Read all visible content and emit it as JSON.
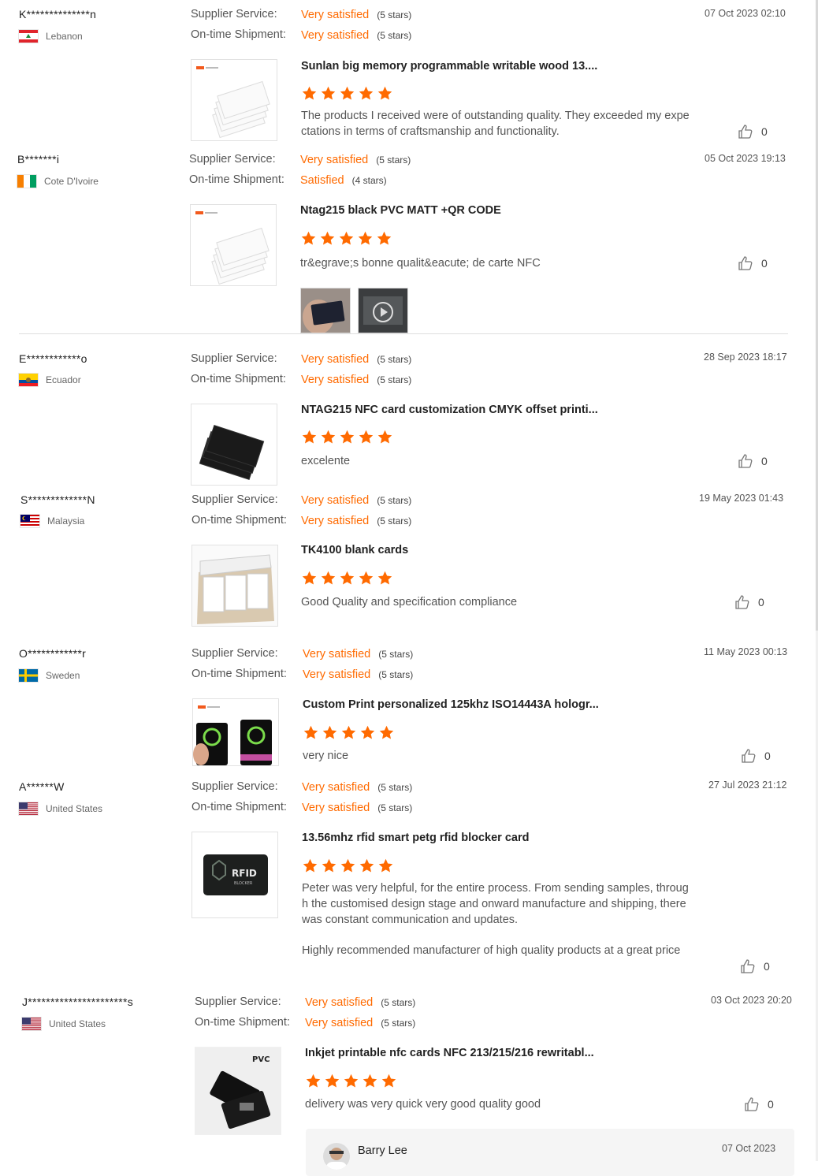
{
  "labels": {
    "supplier_service": "Supplier Service:",
    "ontime_shipment": "On-time Shipment:"
  },
  "colors": {
    "accent": "#ff6a00",
    "text": "#333333",
    "muted": "#666666"
  },
  "reviews": [
    {
      "name": "K**************n",
      "country": "Lebanon",
      "flag": "lebanon",
      "supplier_rating": "Very satisfied",
      "supplier_stars": "(5 stars)",
      "shipment_rating": "Very satisfied",
      "shipment_stars": "(5 stars)",
      "date": "07 Oct 2023 02:10",
      "product_title": "Sunlan big memory programmable writable wood 13....",
      "product_rating": 5,
      "text": "The products I received were of outstanding quality. They exceeded my expectations in terms of craftsmanship and functionality.",
      "likes": "0"
    },
    {
      "name": "B*******i",
      "country": "Cote D'Ivoire",
      "flag": "cote-divoire",
      "supplier_rating": "Very satisfied",
      "supplier_stars": "(5 stars)",
      "shipment_rating": "Satisfied",
      "shipment_stars": "(4 stars)",
      "date": "05 Oct 2023 19:13",
      "product_title": "Ntag215 black PVC MATT +QR CODE",
      "product_rating": 5,
      "text": "tr&egrave;s bonne qualit&eacute; de carte NFC",
      "likes": "0"
    },
    {
      "name": "E************o",
      "country": "Ecuador",
      "flag": "ecuador",
      "supplier_rating": "Very satisfied",
      "supplier_stars": "(5 stars)",
      "shipment_rating": "Very satisfied",
      "shipment_stars": "(5 stars)",
      "date": "28 Sep 2023 18:17",
      "product_title": "NTAG215 NFC card customization CMYK offset printi...",
      "product_rating": 5,
      "text": "excelente",
      "likes": "0"
    },
    {
      "name": "S*************N",
      "country": "Malaysia",
      "flag": "malaysia",
      "supplier_rating": "Very satisfied",
      "supplier_stars": "(5 stars)",
      "shipment_rating": "Very satisfied",
      "shipment_stars": "(5 stars)",
      "date": "19 May 2023 01:43",
      "product_title": "TK4100 blank cards",
      "product_rating": 5,
      "text": "Good Quality and specification compliance",
      "likes": "0"
    },
    {
      "name": "O************r",
      "country": "Sweden",
      "flag": "sweden",
      "supplier_rating": "Very satisfied",
      "supplier_stars": "(5 stars)",
      "shipment_rating": "Very satisfied",
      "shipment_stars": "(5 stars)",
      "date": "11 May 2023 00:13",
      "product_title": "Custom Print personalized 125khz ISO14443A hologr...",
      "product_rating": 5,
      "text": "very nice",
      "likes": "0"
    },
    {
      "name": "A******W",
      "country": "United States",
      "flag": "usa",
      "supplier_rating": "Very satisfied",
      "supplier_stars": "(5 stars)",
      "shipment_rating": "Very satisfied",
      "shipment_stars": "(5 stars)",
      "date": "27 Jul 2023 21:12",
      "product_title": "13.56mhz rfid smart petg rfid blocker card",
      "product_rating": 5,
      "text": "Peter was very helpful, for the entire process. From sending samples, through the customised design stage and onward manufacture and shipping, there was constant communication and updates.",
      "text2": "Highly recommended manufacturer of high quality products at a great price",
      "likes": "0"
    },
    {
      "name": "J**********************s",
      "country": "United States",
      "flag": "usa",
      "supplier_rating": "Very satisfied",
      "supplier_stars": "(5 stars)",
      "shipment_rating": "Very satisfied",
      "shipment_stars": "(5 stars)",
      "date": "03 Oct 2023 20:20",
      "product_title": "Inkjet printable nfc cards NFC 213/215/216 rewritabl...",
      "product_rating": 5,
      "text": "delivery was very quick very good quality good",
      "likes": "0",
      "reply": {
        "author": "Barry Lee",
        "date": "07 Oct 2023"
      }
    }
  ],
  "thumb_text": {
    "rfid": "RFID",
    "blocker": "BLOCKER",
    "pvc": "PVC"
  }
}
